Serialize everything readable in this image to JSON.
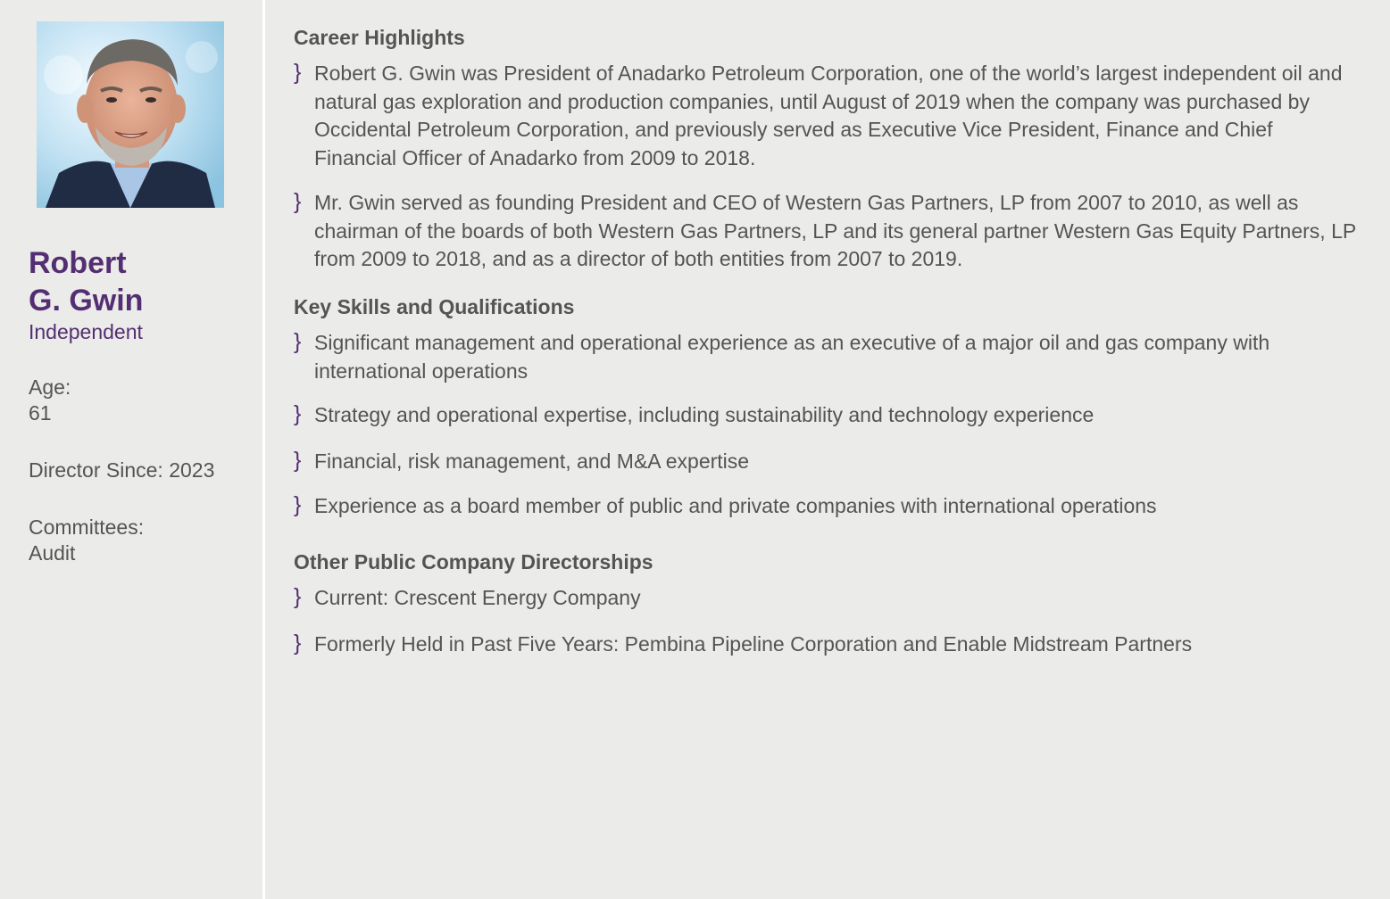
{
  "profile": {
    "name_line1": "Robert",
    "name_line2": "G. Gwin",
    "status": "Independent",
    "age_label": "Age:",
    "age_value": "61",
    "director_since": "Director Since: 2023",
    "committees_label": "Committees:",
    "committees_value": "Audit"
  },
  "career": {
    "title": "Career Highlights",
    "items": [
      "Robert G. Gwin was President of Anadarko Petroleum Corporation, one of the world’s largest independent oil and natural gas exploration and production companies, until August of 2019 when the company was purchased by Occidental Petroleum Corporation, and previously served as Executive Vice President, Finance and Chief Financial Officer of Anadarko from 2009 to 2018.",
      "Mr. Gwin served as founding President and CEO of Western Gas Partners, LP from 2007 to 2010, as well as chairman of the boards of both Western Gas Partners, LP and its general partner Western Gas Equity Partners, LP from 2009 to 2018, and as a director of both entities from 2007 to 2019."
    ]
  },
  "skills": {
    "title": "Key Skills and Qualifications",
    "items": [
      "Significant management and operational experience as an executive of a major oil and gas company with international operations",
      "Strategy and operational expertise, including sustainability and technology experience",
      "Financial, risk management, and M&A expertise",
      "Experience as a board member of public and private companies with international operations"
    ]
  },
  "directorships": {
    "title": "Other Public Company Directorships",
    "items": [
      "Current: Crescent Energy Company",
      "Formerly Held in Past Five Years: Pembina Pipeline Corporation and Enable Midstream Partners"
    ]
  },
  "bullet_glyph": "}",
  "colors": {
    "accent": "#542e72",
    "text": "#545454",
    "background": "#ebebe9"
  }
}
